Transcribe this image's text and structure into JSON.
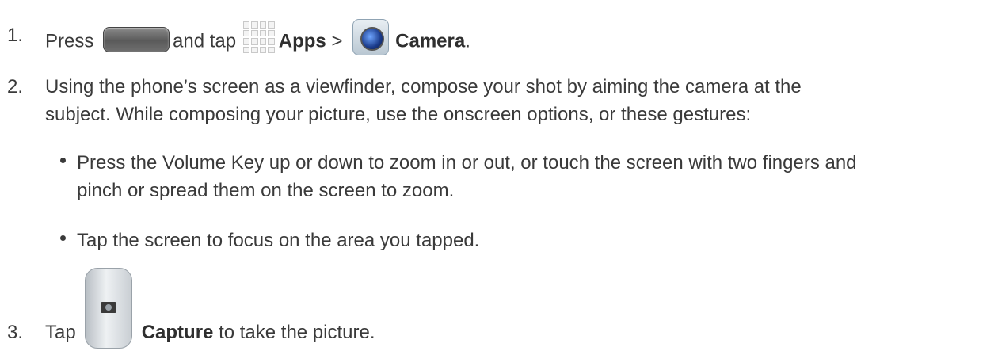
{
  "steps": [
    {
      "num": "1.",
      "press": "Press",
      "and_tap": "and tap",
      "apps": "Apps",
      "sep": ">",
      "camera": "Camera",
      "end": "."
    },
    {
      "num": "2.",
      "line1": "Using the phone’s screen as a viewfinder, compose your shot by aiming the camera at the",
      "line2": "subject. While composing your picture, use the onscreen options, or these gestures:"
    },
    {
      "num": "3.",
      "tap": "Tap",
      "capture": "Capture",
      "rest": "to take the picture."
    }
  ],
  "bullets": [
    {
      "line1": "Press the Volume Key up or down to zoom in or out, or touch the screen with two fingers and",
      "line2": "pinch or spread them on the screen to zoom."
    },
    {
      "line1": "Tap the screen to focus on the area you tapped."
    }
  ],
  "icons": {
    "home_key": "home-key-icon",
    "apps": "apps-grid-icon",
    "camera": "camera-app-icon",
    "capture": "capture-button-icon"
  }
}
